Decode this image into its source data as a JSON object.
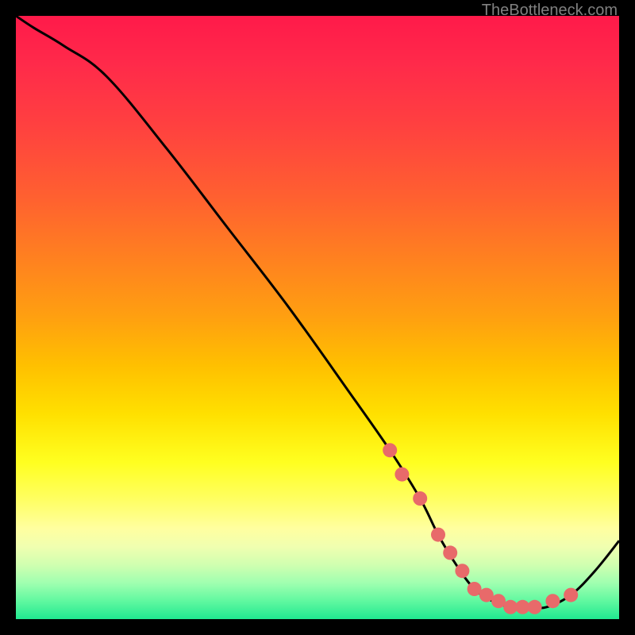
{
  "attribution": "TheBottleneck.com",
  "chart_data": {
    "type": "line",
    "title": "",
    "xlabel": "",
    "ylabel": "",
    "xlim": [
      0,
      100
    ],
    "ylim": [
      0,
      100
    ],
    "series": [
      {
        "name": "curve",
        "x": [
          0,
          3,
          8,
          15,
          25,
          35,
          45,
          55,
          62,
          67,
          70,
          73,
          76,
          79,
          82,
          85,
          88,
          92,
          96,
          100
        ],
        "values": [
          100,
          98,
          95,
          90,
          78,
          65,
          52,
          38,
          28,
          20,
          14,
          9,
          5,
          3,
          2,
          2,
          2,
          4,
          8,
          13
        ]
      }
    ],
    "markers": {
      "name": "highlight-points",
      "color": "#e86a6a",
      "x": [
        62,
        64,
        67,
        70,
        72,
        74,
        76,
        78,
        80,
        82,
        84,
        86,
        89,
        92
      ],
      "values": [
        28,
        24,
        20,
        14,
        11,
        8,
        5,
        4,
        3,
        2,
        2,
        2,
        3,
        4
      ]
    }
  }
}
